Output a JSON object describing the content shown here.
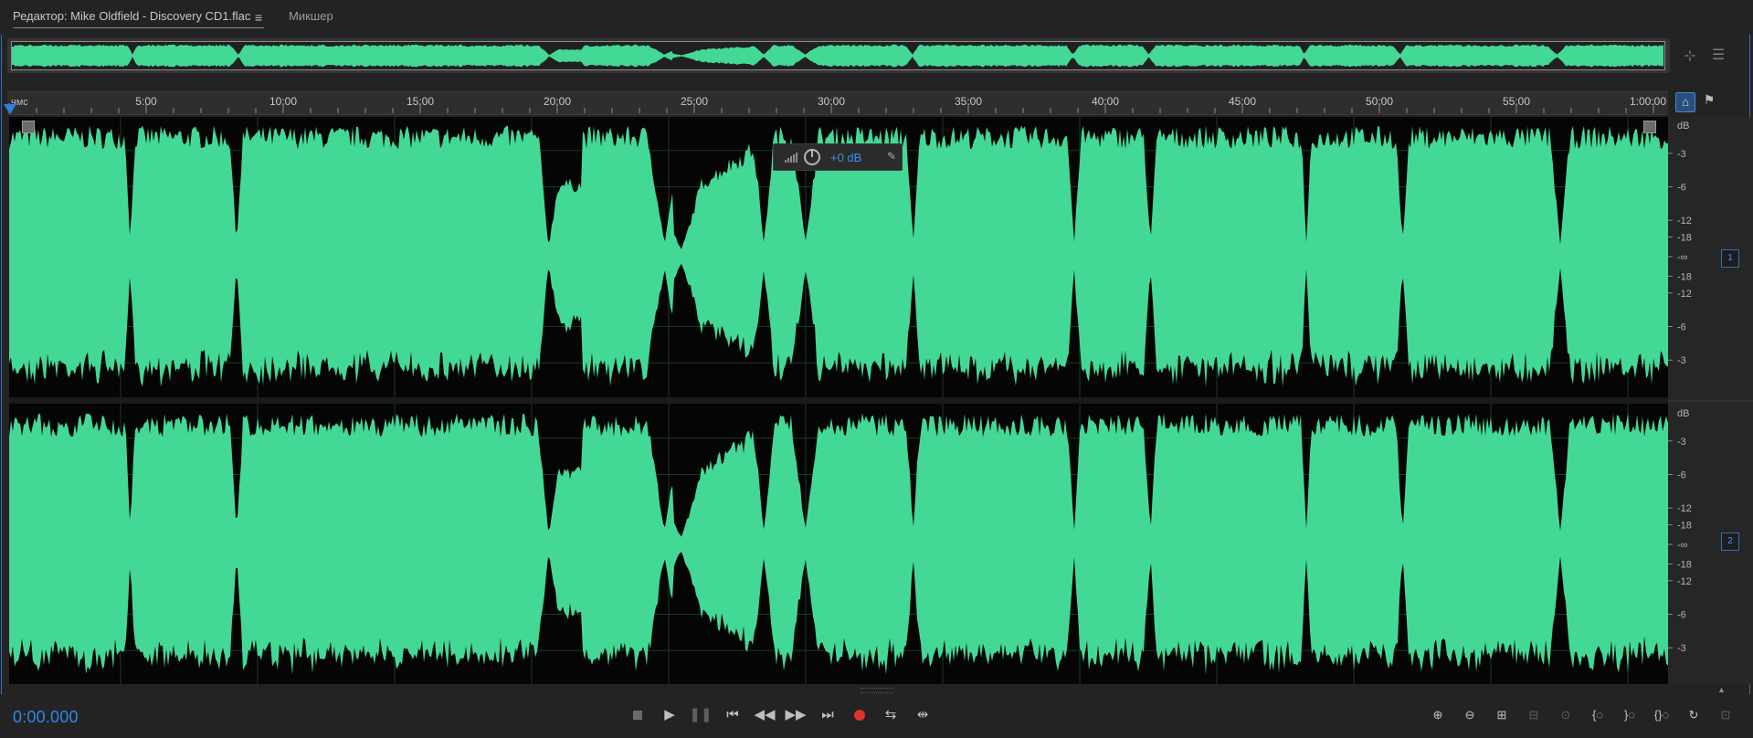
{
  "window": {
    "tabs": [
      {
        "label": "Редактор: Mike Oldfield - Discovery CD1.flac",
        "active": true
      },
      {
        "label": "Микшер",
        "active": false
      }
    ],
    "tab_menu_icon": "hamburger-icon"
  },
  "ruler": {
    "unit_label": "чмс",
    "ticks": [
      "5:00",
      "10:00",
      "15:00",
      "20:00",
      "25:00",
      "30:00",
      "35:00",
      "40:00",
      "45:00",
      "50:00",
      "55:00",
      "1:00:00"
    ]
  },
  "hud": {
    "volume": "+0 dB",
    "icons": [
      "level-meter-icon",
      "volume-knob-icon",
      "pin-icon"
    ]
  },
  "db_scale": {
    "channels": [
      {
        "unit": "dB",
        "labels": [
          "-3",
          "-6",
          "-12",
          "-18",
          "-∞",
          "-18",
          "-12",
          "-6",
          "-3"
        ],
        "badge": "1"
      },
      {
        "unit": "dB",
        "labels": [
          "-3",
          "-6",
          "-12",
          "-18",
          "-∞",
          "-18",
          "-12",
          "-6",
          "-3"
        ],
        "badge": "2"
      }
    ]
  },
  "transport": {
    "time": "0:00.000",
    "buttons": [
      "stop-icon",
      "play-icon",
      "pause-icon",
      "skip-to-start-icon",
      "rewind-icon",
      "fast-forward-icon",
      "skip-to-end-icon",
      "record-icon",
      "loop-icon",
      "skip-selection-icon"
    ]
  },
  "zoom": {
    "buttons": [
      "zoom-in-amplitude-icon",
      "zoom-out-amplitude-icon",
      "zoom-in-time-icon",
      "zoom-out-time-icon",
      "zoom-to-selection-icon",
      "zoom-in-left-icon",
      "zoom-in-right-icon",
      "zoom-out-full-icon",
      "zoom-reset-icon",
      "zoom-selection-icon"
    ]
  },
  "colors": {
    "waveform": "#44d897",
    "accent": "#2f86f2",
    "record": "#e0312b",
    "background": "#232323"
  }
}
